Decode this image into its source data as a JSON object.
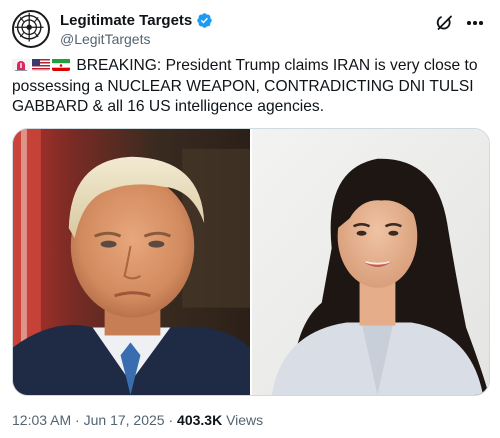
{
  "account": {
    "display_name": "Legitimate Targets",
    "handle": "@LegitTargets",
    "verified_icon": "verified-badge-icon",
    "avatar_icon": "crosshair-logo-icon"
  },
  "actions": {
    "grok_icon": "grok-icon",
    "more_icon": "more-options-icon"
  },
  "tweet": {
    "flags": [
      "flag-icon-emergency-light",
      "flag-icon-us",
      "flag-icon-iran"
    ],
    "text": "BREAKING: President Trump claims IRAN is very close to possessing a NUCLEAR WEAPON, CONTRADICTING DNI TULSI GABBARD & all 16 US intelligence agencies."
  },
  "meta": {
    "time": "12:03 AM",
    "separator": " · ",
    "date": "Jun 17, 2025",
    "views_count": "403.3K",
    "views_label": " Views"
  },
  "colors": {
    "verified": "#1d9bf0",
    "text": "#0f1419",
    "secondary": "#536471"
  }
}
